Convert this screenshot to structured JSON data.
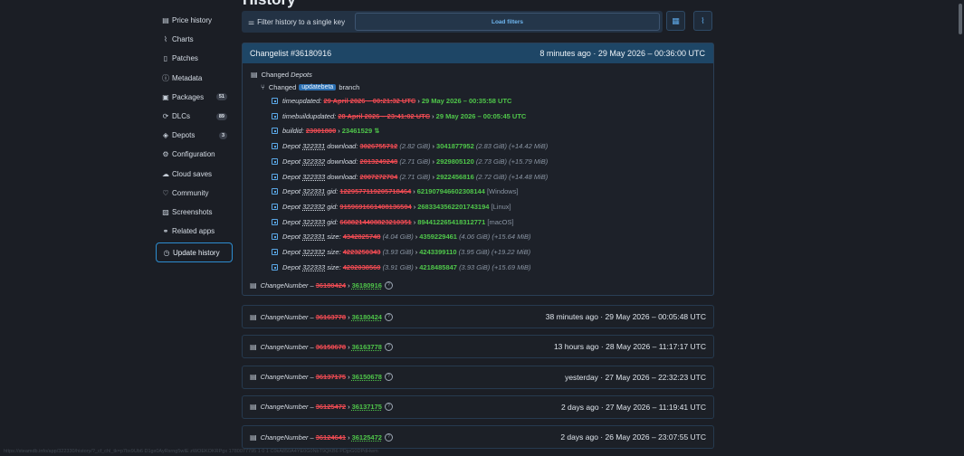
{
  "page": {
    "heading": "History"
  },
  "sidebar": {
    "items": [
      {
        "label": "Price history",
        "icon": "price-history-icon",
        "glyph": "▤"
      },
      {
        "label": "Charts",
        "icon": "chart-icon",
        "glyph": "⌇"
      },
      {
        "label": "Patches",
        "icon": "patches-icon",
        "glyph": "▯"
      },
      {
        "label": "Metadata",
        "icon": "info-icon",
        "glyph": "ⓘ"
      },
      {
        "label": "Packages",
        "icon": "package-icon",
        "glyph": "▣",
        "badge": "51"
      },
      {
        "label": "DLCs",
        "icon": "dlc-icon",
        "glyph": "⟳",
        "badge": "89"
      },
      {
        "label": "Depots",
        "icon": "depots-icon",
        "glyph": "◈",
        "badge": "3"
      },
      {
        "label": "Configuration",
        "icon": "gear-icon",
        "glyph": "⚙"
      },
      {
        "label": "Cloud saves",
        "icon": "cloud-icon",
        "glyph": "☁"
      },
      {
        "label": "Community",
        "icon": "heart-icon",
        "glyph": "♡"
      },
      {
        "label": "Screenshots",
        "icon": "image-icon",
        "glyph": "▨"
      },
      {
        "label": "Related apps",
        "icon": "link-icon",
        "glyph": "⚭"
      },
      {
        "label": "Update history",
        "icon": "history-icon",
        "glyph": "◷",
        "active": true
      }
    ]
  },
  "filter": {
    "label": "Filter history to a single key",
    "button": "Load filters"
  },
  "card": {
    "title": "Changelist #36180916",
    "time": "8 minutes ago · 29 May 2026 – 00:36:00 UTC",
    "changed_depots": "Changed",
    "depots_word": "Depots",
    "branch_prefix": "Changed",
    "branch_tag": "updatebeta",
    "branch_suffix": "branch",
    "lines": [
      {
        "key": "timeupdated:",
        "old": "29 April 2026 – 00:21:32 UTC",
        "new": "29 May 2026 – 00:35:58 UTC"
      },
      {
        "key": "timebuildupdated:",
        "old": "28 April 2026 – 23:41:02 UTC",
        "new": "29 May 2026 – 00:05:45 UTC"
      },
      {
        "key": "buildid:",
        "old": "23001800",
        "new": "23461529",
        "extra": "⇅"
      },
      {
        "depot": "322331",
        "key": "download:",
        "old": "3026755712",
        "old_note": "(2.82 GiB)",
        "new": "3041877952",
        "new_note": "(2.83 GiB)",
        "diff": "(+14.42 MiB)"
      },
      {
        "depot": "322332",
        "key": "download:",
        "old": "2013249248",
        "old_note": "(2.71 GiB)",
        "new": "2929805120",
        "new_note": "(2.73 GiB)",
        "diff": "(+15.79 MiB)"
      },
      {
        "depot": "322333",
        "key": "download:",
        "old": "2007272704",
        "old_note": "(2.71 GiB)",
        "new": "2922456816",
        "new_note": "(2.72 GiB)",
        "diff": "(+14.48 MiB)"
      },
      {
        "depot": "322331",
        "key": "gid:",
        "old": "1229577119205718464",
        "new": "621907946602308144",
        "tail": "[Windows]"
      },
      {
        "depot": "322332",
        "key": "gid:",
        "old": "9159691661408136504",
        "new": "2683343562201743194",
        "tail": "[Linux]"
      },
      {
        "depot": "322333",
        "key": "gid:",
        "old": "6688214408823210351",
        "new": "894412265418312771",
        "tail": "[macOS]"
      },
      {
        "depot": "322331",
        "key": "size:",
        "old": "4342825748",
        "old_note": "(4.04 GiB)",
        "new": "4359229461",
        "new_note": "(4.06 GiB)",
        "diff": "(+15.64 MiB)"
      },
      {
        "depot": "322332",
        "key": "size:",
        "old": "4223250343",
        "old_note": "(3.93 GiB)",
        "new": "4243399110",
        "new_note": "(3.95 GiB)",
        "diff": "(+19.22 MiB)"
      },
      {
        "depot": "322333",
        "key": "size:",
        "old": "4202038560",
        "old_note": "(3.91 GiB)",
        "new": "4218485847",
        "new_note": "(3.93 GiB)",
        "diff": "(+15.69 MiB)"
      }
    ],
    "depot_word": "Depot",
    "footer": {
      "key": "ChangeNumber",
      "dash": "–",
      "old": "36180424",
      "new": "36180916"
    }
  },
  "rows": [
    {
      "key": "ChangeNumber",
      "dash": "–",
      "old": "36163778",
      "new": "36180424",
      "time": "38 minutes ago · 29 May 2026 – 00:05:48 UTC"
    },
    {
      "key": "ChangeNumber",
      "dash": "–",
      "old": "36150678",
      "new": "36163778",
      "time": "13 hours ago · 28 May 2026 – 11:17:17 UTC"
    },
    {
      "key": "ChangeNumber",
      "dash": "–",
      "old": "36137175",
      "new": "36150678",
      "time": "yesterday · 27 May 2026 – 22:32:23 UTC"
    },
    {
      "key": "ChangeNumber",
      "dash": "–",
      "old": "36125472",
      "new": "36137175",
      "time": "2 days ago · 27 May 2026 – 11:19:41 UTC"
    },
    {
      "key": "ChangeNumber",
      "dash": "–",
      "old": "36124641",
      "new": "36125472",
      "time": "2 days ago · 26 May 2026 – 23:07:55 UTC"
    }
  ],
  "status_url": "https://steamdb.info/app/322330/history/?_cf_chl_tk=p7bx9Ub6 D1gx0AyRsrng5wIE zWOEKOKRPgx 1780077795 1 0 1 C0kA850A4YE0G0NbT9QKB6 PDjpG0DPdHwm"
}
